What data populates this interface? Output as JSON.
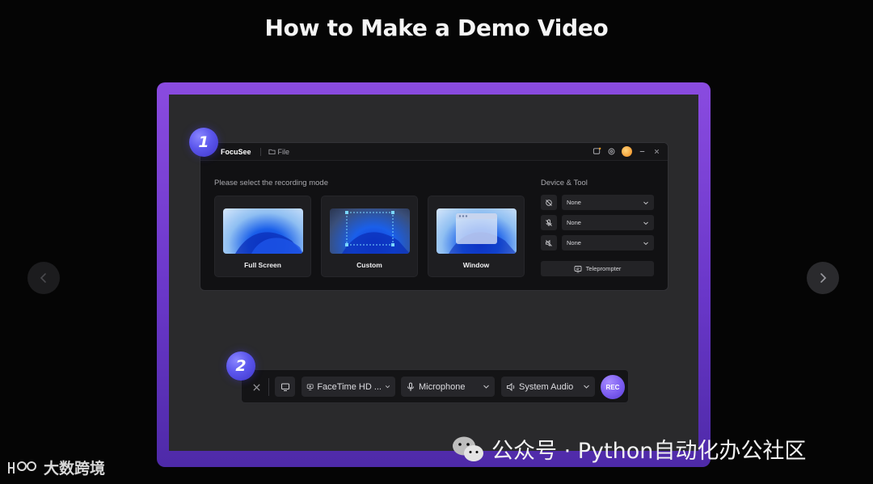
{
  "page": {
    "title": "How to Make a Demo Video"
  },
  "app": {
    "name": "FocuSee",
    "file_menu": "File",
    "mode_prompt": "Please select the recording mode",
    "modes": [
      {
        "label": "Full Screen",
        "icon": "fullscreen-thumbnail"
      },
      {
        "label": "Custom",
        "icon": "custom-area-thumbnail"
      },
      {
        "label": "Window",
        "icon": "window-thumbnail"
      }
    ],
    "device_tool_label": "Device & Tool",
    "devices": [
      {
        "icon": "camera-off-icon",
        "value": "None"
      },
      {
        "icon": "mic-off-icon",
        "value": "None"
      },
      {
        "icon": "speaker-off-icon",
        "value": "None"
      }
    ],
    "teleprompter_label": "Teleprompter"
  },
  "steps": {
    "step1": "1",
    "step2": "2"
  },
  "recorder": {
    "camera": "FaceTime HD ...",
    "microphone": "Microphone",
    "audio": "System Audio",
    "rec_label": "REC"
  },
  "watermark": {
    "text": "公众号 · Python自动化办公社区",
    "icon": "wechat-icon"
  },
  "corner_logo": {
    "text": "大数跨境"
  },
  "colors": {
    "frame_accent": "#7b45d8",
    "badge": "#5b56ec",
    "rec_button": "#7b5cf0",
    "background": "#050505"
  }
}
